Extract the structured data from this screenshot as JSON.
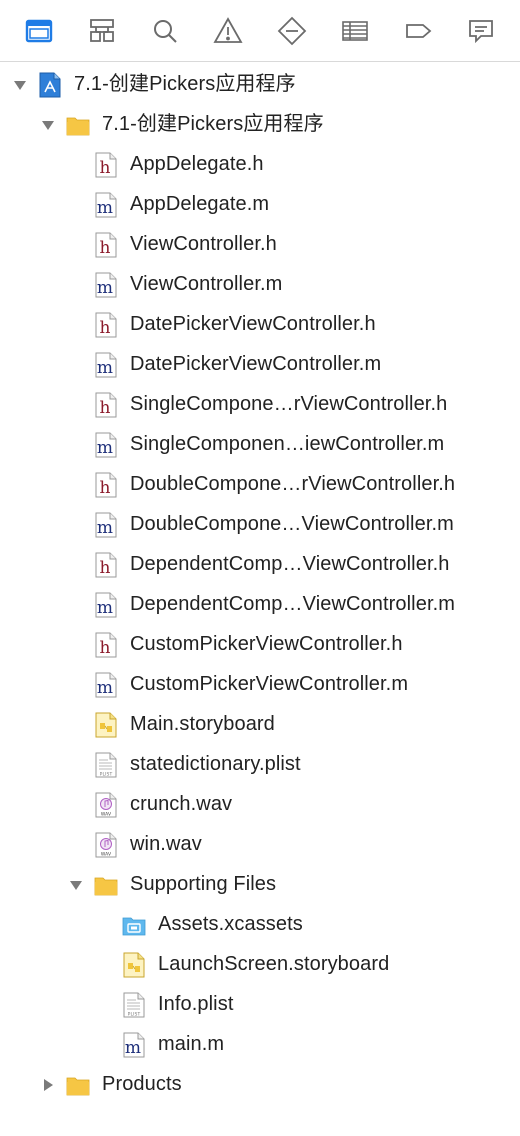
{
  "toolbar": {
    "icons": [
      "project-navigator-icon",
      "symbol-navigator-icon",
      "find-navigator-icon",
      "issue-navigator-icon",
      "test-navigator-icon",
      "debug-navigator-icon",
      "breakpoint-navigator-icon",
      "report-navigator-icon"
    ],
    "active_color": "#1f7ce6",
    "inactive_color": "#6b6b6b"
  },
  "colors": {
    "folder": "#f6c644",
    "h_letter": "#8b1a2b",
    "m_letter": "#1e2f7a",
    "assets_folder": "#5fb8ee"
  },
  "tree": [
    {
      "label": "7.1-创建Pickers应用程序",
      "type": "project",
      "level": 0,
      "disclosure": "open"
    },
    {
      "label": "7.1-创建Pickers应用程序",
      "type": "folder",
      "level": 1,
      "disclosure": "open"
    },
    {
      "label": "AppDelegate.h",
      "type": "h",
      "level": 2
    },
    {
      "label": "AppDelegate.m",
      "type": "m",
      "level": 2
    },
    {
      "label": "ViewController.h",
      "type": "h",
      "level": 2
    },
    {
      "label": "ViewController.m",
      "type": "m",
      "level": 2
    },
    {
      "label": "DatePickerViewController.h",
      "type": "h",
      "level": 2
    },
    {
      "label": "DatePickerViewController.m",
      "type": "m",
      "level": 2
    },
    {
      "label": "SingleCompone…rViewController.h",
      "type": "h",
      "level": 2
    },
    {
      "label": "SingleComponen…iewController.m",
      "type": "m",
      "level": 2
    },
    {
      "label": "DoubleCompone…rViewController.h",
      "type": "h",
      "level": 2
    },
    {
      "label": "DoubleCompone…ViewController.m",
      "type": "m",
      "level": 2
    },
    {
      "label": "DependentComp…ViewController.h",
      "type": "h",
      "level": 2
    },
    {
      "label": "DependentComp…ViewController.m",
      "type": "m",
      "level": 2
    },
    {
      "label": "CustomPickerViewController.h",
      "type": "h",
      "level": 2
    },
    {
      "label": "CustomPickerViewController.m",
      "type": "m",
      "level": 2
    },
    {
      "label": "Main.storyboard",
      "type": "storyboard",
      "level": 2
    },
    {
      "label": "statedictionary.plist",
      "type": "plist",
      "level": 2
    },
    {
      "label": "crunch.wav",
      "type": "wav",
      "level": 2
    },
    {
      "label": "win.wav",
      "type": "wav",
      "level": 2
    },
    {
      "label": "Supporting Files",
      "type": "folder",
      "level": 2,
      "disclosure": "open"
    },
    {
      "label": "Assets.xcassets",
      "type": "assets",
      "level": 3
    },
    {
      "label": "LaunchScreen.storyboard",
      "type": "storyboard",
      "level": 3
    },
    {
      "label": "Info.plist",
      "type": "plist",
      "level": 3
    },
    {
      "label": "main.m",
      "type": "m",
      "level": 3
    },
    {
      "label": "Products",
      "type": "folder",
      "level": 1,
      "disclosure": "closed"
    }
  ],
  "icon_text": {
    "h": "h",
    "m": "m",
    "plist": "PLIST",
    "wav": "WAV"
  }
}
